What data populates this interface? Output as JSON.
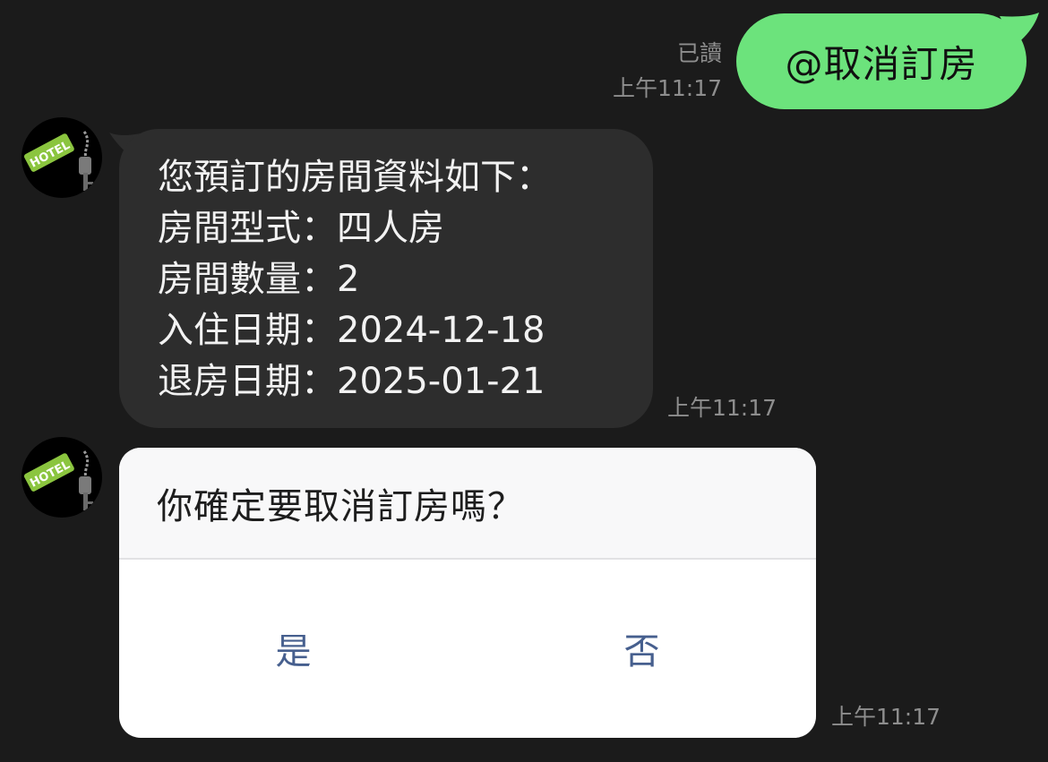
{
  "messages": {
    "outgoing": {
      "text": "@取消訂房",
      "read_label": "已讀",
      "time": "上午11:17"
    },
    "booking_info": {
      "lines": [
        "您預訂的房間資料如下：",
        "房間型式：四人房",
        "房間數量：2",
        "入住日期：2024-12-18",
        "退房日期：2025-01-21"
      ],
      "time": "上午11:17"
    },
    "confirm": {
      "question": "你確定要取消訂房嗎？",
      "yes_label": "是",
      "no_label": "否",
      "time": "上午11:17"
    }
  },
  "avatar": {
    "icon": "hotel-key-icon",
    "tag_text": "HOTEL"
  },
  "colors": {
    "background": "#1b1b1b",
    "outgoing_bubble": "#6ce37c",
    "incoming_bubble": "#2d2d2d",
    "card_button_text": "#465f8e",
    "timestamp": "#8e8e8e"
  }
}
